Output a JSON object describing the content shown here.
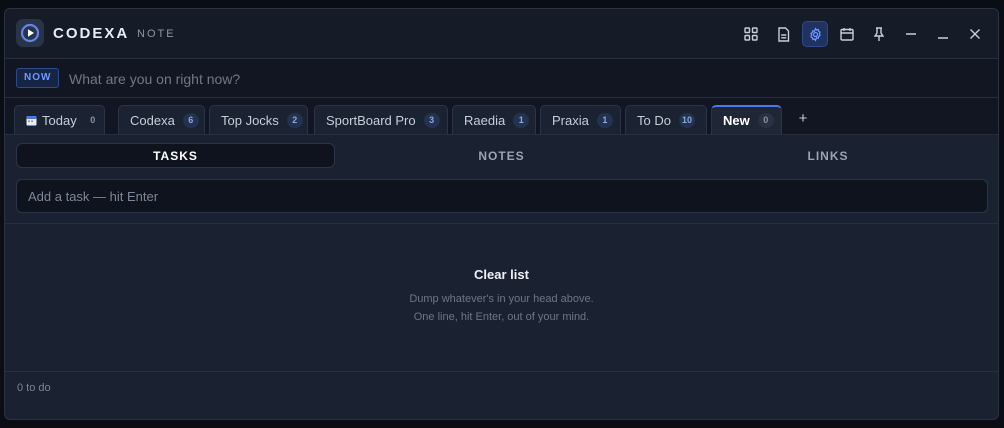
{
  "app": {
    "brand": "CODEXA",
    "sub": "NOTE"
  },
  "toolbar": {
    "icons": [
      "grid-icon",
      "document-icon",
      "gear-icon",
      "calendar-icon",
      "pin-icon",
      "minimize-dash-icon",
      "minimize-icon",
      "close-icon"
    ],
    "active": "gear-icon",
    "accent": "#4a78e8"
  },
  "now": {
    "badge": "NOW",
    "placeholder": "What are you on right now?"
  },
  "tabs": [
    {
      "label": "Today",
      "count": "0"
    },
    {
      "label": "Codexa",
      "count": "6"
    },
    {
      "label": "Top Jocks",
      "count": "2"
    },
    {
      "label": "SportBoard Pro",
      "count": "3"
    },
    {
      "label": "Raedia",
      "count": "1"
    },
    {
      "label": "Praxia",
      "count": "1"
    },
    {
      "label": "To Do",
      "count": "10"
    },
    {
      "label": "New",
      "count": "0"
    }
  ],
  "add_tab": "+",
  "subtabs": [
    {
      "label": "TASKS"
    },
    {
      "label": "NOTES"
    },
    {
      "label": "LINKS"
    }
  ],
  "task_input": {
    "placeholder": "Add a task — hit Enter"
  },
  "empty": {
    "title": "Clear list",
    "line1": "Dump whatever's in your head above.",
    "line2": "One line, hit Enter, out of your mind."
  },
  "footer": {
    "count": "0 to do"
  }
}
